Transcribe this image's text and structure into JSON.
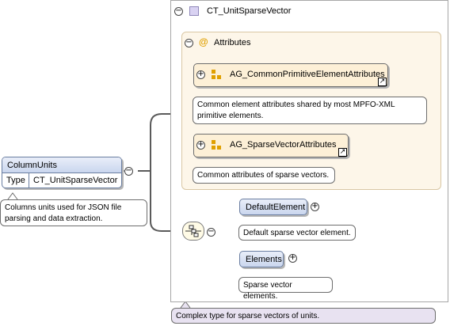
{
  "complex_type": {
    "name": "CT_UnitSparseVector",
    "collapse_symbol": "−",
    "documentation": "Complex type for sparse vectors of units."
  },
  "attributes": {
    "label": "Attributes",
    "at_symbol": "@",
    "collapse_symbol": "−",
    "groups": [
      {
        "name": "AG_CommonPrimitiveElementAttributes",
        "expand_symbol": "+",
        "link_symbol": "↗",
        "documentation_line1": "Common element attributes shared by most MPFO-XML",
        "documentation_line2": "primitive elements."
      },
      {
        "name": "AG_SparseVectorAttributes",
        "expand_symbol": "+",
        "link_symbol": "↗",
        "documentation_line1": "Common attributes of sparse vectors.",
        "documentation_line2": ""
      }
    ]
  },
  "root_element": {
    "name": "ColumnUnits",
    "type_label": "Type",
    "type_value": "CT_UnitSparseVector",
    "collapse_symbol": "−",
    "documentation_line1": "Columns units used for JSON file",
    "documentation_line2": "parsing and data extraction."
  },
  "sequence": {
    "collapse_symbol": "−",
    "elements": [
      {
        "name": "DefaultElement",
        "expand_symbol": "+",
        "documentation": "Default sparse vector element."
      },
      {
        "name": "Elements",
        "expand_symbol": "+",
        "documentation": "Sparse vector elements."
      }
    ]
  },
  "colors": {
    "element_fill": "#cad6ee",
    "attribute_fill": "#fdf0d7",
    "attribute_area": "#fdf6e9",
    "type_note_fill": "#e8e2f1",
    "attribute_icon": "#e0a000"
  },
  "icons": {
    "complex_type": "complex-type-icon",
    "attribute_group": "attribute-group-icon",
    "sequence": "sequence-compositor-icon",
    "link": "link-arrow-icon"
  }
}
